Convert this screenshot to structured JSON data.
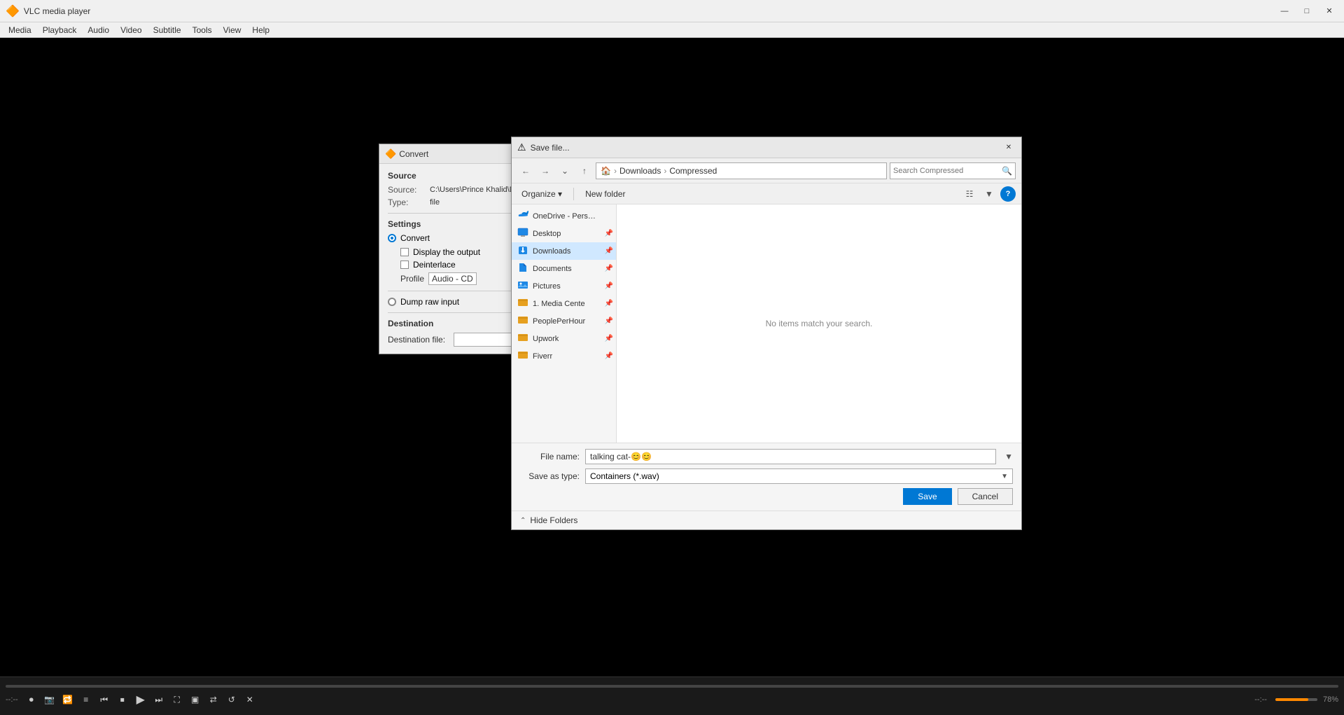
{
  "app": {
    "title": "VLC media player",
    "icon": "🔶"
  },
  "titlebar": {
    "minimize": "—",
    "maximize": "□",
    "close": "✕"
  },
  "menubar": {
    "items": [
      "Media",
      "Playback",
      "Audio",
      "Video",
      "Subtitle",
      "Tools",
      "View",
      "Help"
    ]
  },
  "controls": {
    "time_left": "--:--",
    "time_right": "--:--",
    "volume_label": "78%"
  },
  "convert_dialog": {
    "title": "Convert",
    "icon": "🔶",
    "sections": {
      "source": {
        "label": "Source",
        "source_label": "Source:",
        "source_value": "C:\\Users\\Prince Khalid\\Dow",
        "type_label": "Type:",
        "type_value": "file"
      },
      "settings": {
        "label": "Settings",
        "convert_label": "Convert",
        "display_output_label": "Display the output",
        "deinterlace_label": "Deinterlace",
        "profile_label": "Profile",
        "profile_value": "Audio - CD",
        "dump_label": "Dump raw input"
      },
      "destination": {
        "label": "Destination",
        "dest_file_label": "Destination file:"
      }
    },
    "close": "✕"
  },
  "savefile_dialog": {
    "title": "Save file...",
    "icon": "⚠",
    "close": "✕",
    "breadcrumb": {
      "home_icon": "🏠",
      "path_parts": [
        "Downloads",
        "Compressed"
      ]
    },
    "search_placeholder": "Search Compressed",
    "toolbar": {
      "organize": "Organize",
      "organize_arrow": "▾",
      "new_folder": "New folder"
    },
    "nav": {
      "back_disabled": false,
      "forward_disabled": false
    },
    "sidebar": {
      "items": [
        {
          "name": "OneDrive - Person",
          "type": "onedrive",
          "pinned": false
        },
        {
          "name": "Desktop",
          "type": "desktop",
          "pinned": true
        },
        {
          "name": "Downloads",
          "type": "downloads",
          "pinned": true
        },
        {
          "name": "Documents",
          "type": "documents",
          "pinned": true
        },
        {
          "name": "Pictures",
          "type": "pictures",
          "pinned": true
        },
        {
          "name": "1. Media Cente",
          "type": "folder",
          "pinned": true
        },
        {
          "name": "PeoplePerHour",
          "type": "folder",
          "pinned": true
        },
        {
          "name": "Upwork",
          "type": "folder",
          "pinned": true
        },
        {
          "name": "Fiverr",
          "type": "folder",
          "pinned": true
        }
      ]
    },
    "content": {
      "empty_message": "No items match your search."
    },
    "fields": {
      "filename_label": "File name:",
      "filename_value": "talking cat-😊😊",
      "savetype_label": "Save as type:",
      "savetype_value": "Containers (*.wav)"
    },
    "buttons": {
      "save": "Save",
      "cancel": "Cancel"
    },
    "hide_folders": "Hide Folders"
  }
}
